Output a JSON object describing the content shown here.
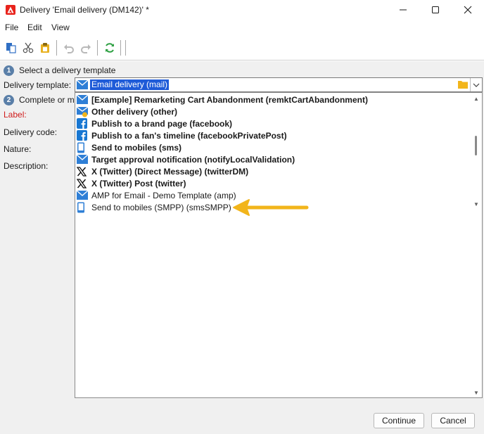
{
  "window": {
    "title": "Delivery 'Email delivery (DM142)' *",
    "controls": {
      "minimize": "minimize-icon",
      "maximize": "maximize-icon",
      "close": "close-icon"
    }
  },
  "menu": [
    "File",
    "Edit",
    "View"
  ],
  "toolbar": {
    "icons": [
      "copy-icon",
      "cut-icon",
      "paste-icon",
      "undo-icon",
      "redo-icon",
      "refresh-icon"
    ]
  },
  "steps": {
    "step1": {
      "number": "1",
      "text": "Select a delivery template"
    },
    "step2": {
      "number": "2",
      "text": "Complete or m"
    }
  },
  "fields": {
    "template_label": "Delivery template:",
    "label_label": "Label:",
    "code_label": "Delivery code:",
    "nature_label": "Nature:",
    "description_label": "Description:"
  },
  "template_combo": {
    "value": "Email delivery (mail)",
    "icon": "email-icon"
  },
  "dropdown_items": [
    {
      "label": "[Example] Remarketing Cart Abandonment (remktCartAbandonment)",
      "icon": "email-icon",
      "bold": true
    },
    {
      "label": "Other delivery (other)",
      "icon": "other-delivery-icon",
      "bold": true
    },
    {
      "label": "Publish to a brand page (facebook)",
      "icon": "facebook-icon",
      "bold": true
    },
    {
      "label": "Publish to a fan's timeline (facebookPrivatePost)",
      "icon": "facebook-icon",
      "bold": true
    },
    {
      "label": "Send to mobiles (sms)",
      "icon": "mobile-icon",
      "bold": true
    },
    {
      "label": "Target approval notification (notifyLocalValidation)",
      "icon": "email-icon",
      "bold": true
    },
    {
      "label": "X (Twitter) (Direct Message) (twitterDM)",
      "icon": "x-twitter-icon",
      "bold": true
    },
    {
      "label": "X (Twitter) Post (twitter)",
      "icon": "x-twitter-icon",
      "bold": true
    },
    {
      "label": "AMP for Email - Demo Template (amp)",
      "icon": "email-icon",
      "bold": false
    },
    {
      "label": "Send to mobiles (SMPP) (smsSMPP)",
      "icon": "mobile-icon",
      "bold": false
    }
  ],
  "buttons": {
    "continue": "Continue",
    "cancel": "Cancel"
  },
  "colors": {
    "selection": "#1e5bd8",
    "annotation_arrow": "#f2b51b",
    "required_label": "#d01c1c"
  }
}
